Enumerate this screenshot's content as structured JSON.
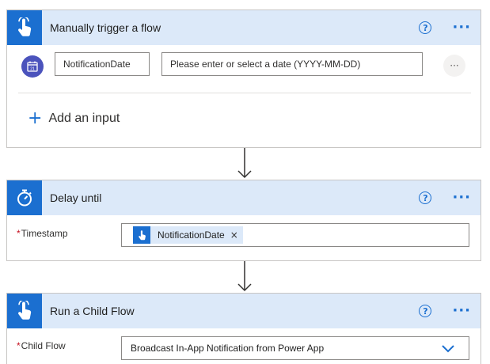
{
  "trigger": {
    "title": "Manually trigger a flow",
    "input_name": "NotificationDate",
    "input_placeholder": "Please enter or select a date (YYYY-MM-DD)",
    "more_label": "···",
    "add_input_label": "Add an input",
    "icons": [
      "touch-icon",
      "help-icon",
      "more-icon",
      "calendar-icon",
      "plus-icon"
    ]
  },
  "delay": {
    "title": "Delay until",
    "field_label": "Timestamp",
    "required_marker": "*",
    "token_label": "NotificationDate",
    "token_remove": "×",
    "icons": [
      "stopwatch-icon",
      "help-icon",
      "more-icon",
      "touch-icon",
      "remove-icon"
    ]
  },
  "child": {
    "title": "Run a Child Flow",
    "field_label": "Child Flow",
    "required_marker": "*",
    "selected_value": "Broadcast In-App Notification from Power App",
    "icons": [
      "touch-icon",
      "help-icon",
      "more-icon",
      "chevron-down-icon"
    ]
  },
  "common": {
    "help_glyph": "?",
    "more_glyph": "···"
  },
  "colors": {
    "accent": "#1b6fd0",
    "header_bg": "#dce9f9",
    "calendar_badge": "#4b53bc",
    "required": "#c50f1f"
  }
}
